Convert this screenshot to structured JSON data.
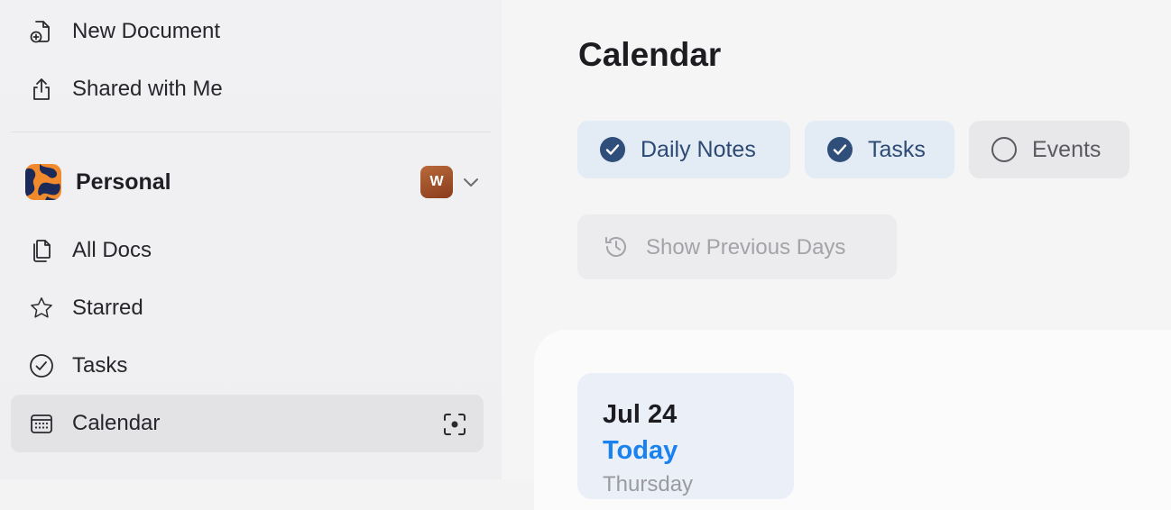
{
  "sidebar": {
    "top_items": [
      {
        "label": "New Document",
        "icon": "new-document-icon"
      },
      {
        "label": "Shared with Me",
        "icon": "share-icon"
      }
    ],
    "workspace": {
      "name": "Personal",
      "user_initial": "W",
      "user_badge_color": "#9c4a26"
    },
    "items": [
      {
        "label": "All Docs",
        "icon": "documents-icon"
      },
      {
        "label": "Starred",
        "icon": "star-icon"
      },
      {
        "label": "Tasks",
        "icon": "check-circle-icon"
      },
      {
        "label": "Calendar",
        "icon": "calendar-icon",
        "active": true
      }
    ]
  },
  "main": {
    "title": "Calendar",
    "filters": [
      {
        "label": "Daily Notes",
        "checked": true
      },
      {
        "label": "Tasks",
        "checked": true
      },
      {
        "label": "Events",
        "checked": false
      }
    ],
    "show_previous_label": "Show Previous Days",
    "day_card": {
      "date": "Jul 24",
      "relative": "Today",
      "weekday": "Thursday"
    }
  },
  "colors": {
    "accent_blue": "#1a82f0",
    "chip_active_bg": "#e3ebf4",
    "check_fill": "#2f4f7a",
    "active_sidebar_bg": "#e3e3e6"
  }
}
